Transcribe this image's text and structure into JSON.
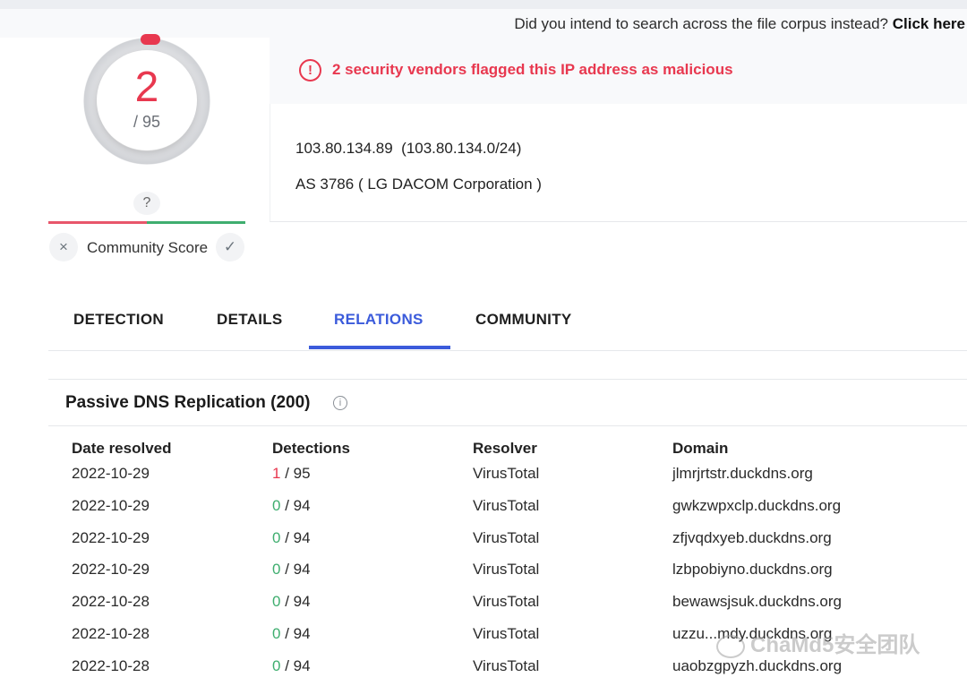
{
  "corpus_notice": {
    "text": "Did you intend to search across the file corpus instead?",
    "link": "Click here"
  },
  "score": {
    "detections": "2",
    "total": "/ 95",
    "unknown_mark": "?",
    "community_label": "Community Score",
    "down_icon": "×",
    "up_icon": "✓"
  },
  "alert": {
    "icon": "!",
    "text": "2 security vendors flagged this IP address as malicious"
  },
  "ip_info": {
    "ip_line": "103.80.134.89  (103.80.134.0/24)",
    "as_line": "AS 3786 ( LG DACOM Corporation )"
  },
  "tabs": [
    {
      "label": "DETECTION"
    },
    {
      "label": "DETAILS"
    },
    {
      "label": "RELATIONS",
      "active": true
    },
    {
      "label": "COMMUNITY"
    }
  ],
  "passive_dns": {
    "title": "Passive DNS Replication (200)",
    "info_icon": "i",
    "columns": [
      "Date resolved",
      "Detections",
      "Resolver",
      "Domain"
    ],
    "rows": [
      {
        "date": "2022-10-29",
        "det": "1",
        "det_total": " / 95",
        "resolver": "VirusTotal",
        "domain": "jlmrjrtstr.duckdns.org"
      },
      {
        "date": "2022-10-29",
        "det": "0",
        "det_total": " / 94",
        "resolver": "VirusTotal",
        "domain": "gwkzwpxclp.duckdns.org"
      },
      {
        "date": "2022-10-29",
        "det": "0",
        "det_total": " / 94",
        "resolver": "VirusTotal",
        "domain": "zfjvqdxyeb.duckdns.org"
      },
      {
        "date": "2022-10-29",
        "det": "0",
        "det_total": " / 94",
        "resolver": "VirusTotal",
        "domain": "lzbpobiyno.duckdns.org"
      },
      {
        "date": "2022-10-28",
        "det": "0",
        "det_total": " / 94",
        "resolver": "VirusTotal",
        "domain": "bewawsjsuk.duckdns.org"
      },
      {
        "date": "2022-10-28",
        "det": "0",
        "det_total": " / 94",
        "resolver": "VirusTotal",
        "domain": "uzzu...mdy.duckdns.org"
      },
      {
        "date": "2022-10-28",
        "det": "0",
        "det_total": " / 94",
        "resolver": "VirusTotal",
        "domain": "uaobzgpyzh.duckdns.org"
      }
    ]
  },
  "watermark": "ChaMd5安全团队",
  "colors": {
    "malicious": "#e8384f",
    "clean": "#3fae6f",
    "accent": "#3b5bdb"
  }
}
